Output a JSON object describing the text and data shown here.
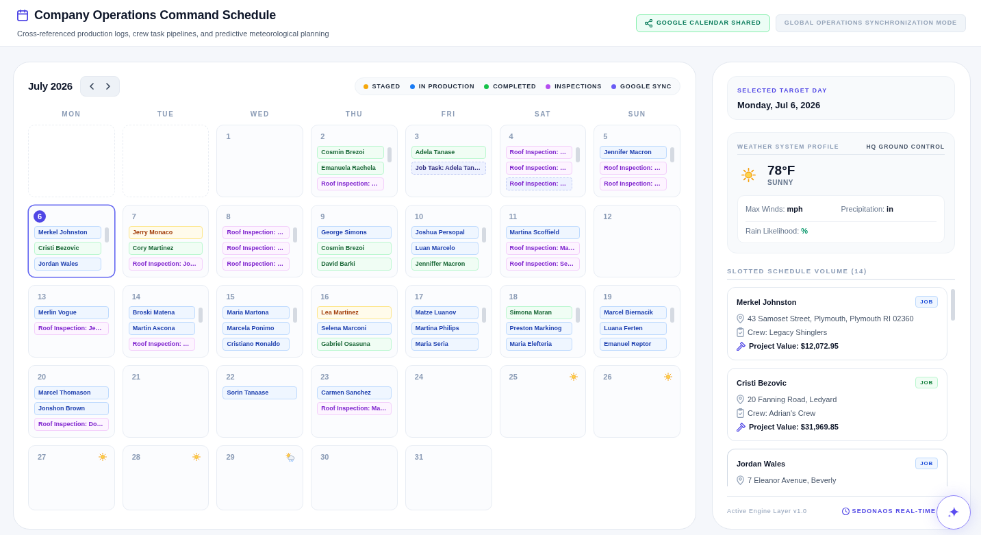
{
  "header": {
    "title": "Company Operations Command Schedule",
    "subtitle": "Cross-referenced production logs, crew task pipelines, and predictive meteorological planning",
    "buttons": [
      {
        "label": "GOOGLE CALENDAR SHARED",
        "kind": "share",
        "disabled": false
      },
      {
        "label": "GLOBAL OPERATIONS SYNCHRONIZATION MODE",
        "kind": "mode",
        "disabled": true
      }
    ]
  },
  "calendar": {
    "month": "July 2026",
    "legend": [
      {
        "label": "STAGED",
        "color": "#f5a70b"
      },
      {
        "label": "IN PRODUCTION",
        "color": "#1a7cf5"
      },
      {
        "label": "COMPLETED",
        "color": "#16c24a"
      },
      {
        "label": "INSPECTIONS",
        "color": "#b44cf0"
      },
      {
        "label": "GOOGLE SYNC",
        "color": "#6a5cf5"
      }
    ],
    "weekdays": [
      "MON",
      "TUE",
      "WED",
      "THU",
      "FRI",
      "SAT",
      "SUN"
    ],
    "cells": [
      {
        "kind": "blank"
      },
      {
        "kind": "blank"
      },
      {
        "kind": "day",
        "date": "1",
        "selected": false,
        "overflow": false
      },
      {
        "kind": "day",
        "date": "2",
        "selected": false,
        "overflow": true,
        "events": [
          {
            "label": "Cosmin Brezoi",
            "kind": "completed",
            "synced": false
          },
          {
            "label": "Emanuela Rachela",
            "kind": "completed",
            "synced": false
          },
          {
            "label": "Roof Inspection: …",
            "kind": "inspection",
            "synced": false
          }
        ]
      },
      {
        "kind": "day",
        "date": "3",
        "selected": false,
        "overflow": false,
        "events": [
          {
            "label": "Adela Tanase",
            "kind": "completed",
            "synced": false
          },
          {
            "label": "Job Task: Adela Tan…",
            "kind": "sync",
            "synced": true
          }
        ]
      },
      {
        "kind": "day",
        "date": "4",
        "selected": false,
        "overflow": true,
        "events": [
          {
            "label": "Roof Inspection: …",
            "kind": "inspection",
            "synced": false
          },
          {
            "label": "Roof Inspection: …",
            "kind": "inspection",
            "synced": false
          },
          {
            "label": "Roof Inspection: …",
            "kind": "inspection",
            "synced": true
          }
        ]
      },
      {
        "kind": "day",
        "date": "5",
        "selected": false,
        "overflow": true,
        "events": [
          {
            "label": "Jennifer Macron",
            "kind": "production",
            "synced": false
          },
          {
            "label": "Roof Inspection: …",
            "kind": "inspection",
            "synced": false
          },
          {
            "label": "Roof Inspection: …",
            "kind": "inspection",
            "synced": false
          }
        ]
      },
      {
        "kind": "day",
        "date": "6",
        "selected": true,
        "overflow": true,
        "events": [
          {
            "label": "Merkel Johnston",
            "kind": "production",
            "synced": false
          },
          {
            "label": "Cristi Bezovic",
            "kind": "completed",
            "synced": false
          },
          {
            "label": "Jordan Wales",
            "kind": "production",
            "synced": false
          }
        ]
      },
      {
        "kind": "day",
        "date": "7",
        "selected": false,
        "overflow": false,
        "events": [
          {
            "label": "Jerry Monaco",
            "kind": "staged",
            "synced": false
          },
          {
            "label": "Cory Martinez",
            "kind": "completed",
            "synced": false
          },
          {
            "label": "Roof Inspection: Jo…",
            "kind": "inspection",
            "synced": false
          }
        ]
      },
      {
        "kind": "day",
        "date": "8",
        "selected": false,
        "overflow": true,
        "events": [
          {
            "label": "Roof Inspection: …",
            "kind": "inspection",
            "synced": false
          },
          {
            "label": "Roof Inspection: …",
            "kind": "inspection",
            "synced": false
          },
          {
            "label": "Roof Inspection: …",
            "kind": "inspection",
            "synced": false
          }
        ]
      },
      {
        "kind": "day",
        "date": "9",
        "selected": false,
        "overflow": false,
        "events": [
          {
            "label": "George Simons",
            "kind": "production",
            "synced": false
          },
          {
            "label": "Cosmin Brezoi",
            "kind": "completed",
            "synced": false
          },
          {
            "label": "David Barki",
            "kind": "completed",
            "synced": false
          }
        ]
      },
      {
        "kind": "day",
        "date": "10",
        "selected": false,
        "overflow": true,
        "events": [
          {
            "label": "Joshua Persopal",
            "kind": "production",
            "synced": false
          },
          {
            "label": "Luan Marcelo",
            "kind": "production",
            "synced": false
          },
          {
            "label": "Jenniffer Macron",
            "kind": "completed",
            "synced": false
          }
        ]
      },
      {
        "kind": "day",
        "date": "11",
        "selected": false,
        "overflow": false,
        "events": [
          {
            "label": "Martina Scoffield",
            "kind": "production",
            "synced": false
          },
          {
            "label": "Roof Inspection: Ma…",
            "kind": "inspection",
            "synced": false
          },
          {
            "label": "Roof Inspection: Se…",
            "kind": "inspection",
            "synced": false
          }
        ]
      },
      {
        "kind": "day",
        "date": "12",
        "selected": false,
        "overflow": false
      },
      {
        "kind": "day",
        "date": "13",
        "selected": false,
        "overflow": false,
        "events": [
          {
            "label": "Merlin Vogue",
            "kind": "production",
            "synced": false
          },
          {
            "label": "Roof Inspection: Je…",
            "kind": "inspection",
            "synced": false
          }
        ]
      },
      {
        "kind": "day",
        "date": "14",
        "selected": false,
        "overflow": true,
        "events": [
          {
            "label": "Broski Matena",
            "kind": "production",
            "synced": false
          },
          {
            "label": "Martin Ascona",
            "kind": "production",
            "synced": false
          },
          {
            "label": "Roof Inspection: …",
            "kind": "inspection",
            "synced": false
          }
        ]
      },
      {
        "kind": "day",
        "date": "15",
        "selected": false,
        "overflow": true,
        "events": [
          {
            "label": "Maria Martona",
            "kind": "production",
            "synced": false
          },
          {
            "label": "Marcela Ponimo",
            "kind": "production",
            "synced": false
          },
          {
            "label": "Cristiano Ronaldo",
            "kind": "production",
            "synced": false
          }
        ]
      },
      {
        "kind": "day",
        "date": "16",
        "selected": false,
        "overflow": false,
        "events": [
          {
            "label": "Lea Martinez",
            "kind": "staged",
            "synced": false
          },
          {
            "label": "Selena Marconi",
            "kind": "production",
            "synced": false
          },
          {
            "label": "Gabriel Osasuna",
            "kind": "completed",
            "synced": false
          }
        ]
      },
      {
        "kind": "day",
        "date": "17",
        "selected": false,
        "overflow": true,
        "events": [
          {
            "label": "Matze Luanov",
            "kind": "production",
            "synced": false
          },
          {
            "label": "Martina Philips",
            "kind": "production",
            "synced": false
          },
          {
            "label": "Maria Seria",
            "kind": "production",
            "synced": false
          }
        ]
      },
      {
        "kind": "day",
        "date": "18",
        "selected": false,
        "overflow": true,
        "events": [
          {
            "label": "Simona Maran",
            "kind": "completed",
            "synced": false
          },
          {
            "label": "Preston Markinog",
            "kind": "production",
            "synced": false
          },
          {
            "label": "Maria Elefteria",
            "kind": "production",
            "synced": false
          }
        ]
      },
      {
        "kind": "day",
        "date": "19",
        "selected": false,
        "overflow": true,
        "events": [
          {
            "label": "Marcel Biernacik",
            "kind": "production",
            "synced": false
          },
          {
            "label": "Luana Ferten",
            "kind": "production",
            "synced": false
          },
          {
            "label": "Emanuel Reptor",
            "kind": "production",
            "synced": false
          }
        ]
      },
      {
        "kind": "day",
        "date": "20",
        "selected": false,
        "overflow": false,
        "events": [
          {
            "label": "Marcel Thomason",
            "kind": "production",
            "synced": false
          },
          {
            "label": "Jonshon Brown",
            "kind": "production",
            "synced": false
          },
          {
            "label": "Roof Inspection: Do…",
            "kind": "inspection",
            "synced": false
          }
        ]
      },
      {
        "kind": "day",
        "date": "21",
        "selected": false,
        "overflow": false
      },
      {
        "kind": "day",
        "date": "22",
        "selected": false,
        "overflow": false,
        "events": [
          {
            "label": "Sorin Tanaase",
            "kind": "production",
            "synced": false
          }
        ]
      },
      {
        "kind": "day",
        "date": "23",
        "selected": false,
        "overflow": false,
        "events": [
          {
            "label": "Carmen Sanchez",
            "kind": "production",
            "synced": false
          },
          {
            "label": "Roof Inspection: Ma…",
            "kind": "inspection",
            "synced": false
          }
        ]
      },
      {
        "kind": "day",
        "date": "24",
        "selected": false,
        "overflow": false
      },
      {
        "kind": "day",
        "date": "25",
        "selected": false,
        "overflow": false,
        "weather": {
          "kind": "sunny"
        }
      },
      {
        "kind": "day",
        "date": "26",
        "selected": false,
        "overflow": false,
        "weather": {
          "kind": "sunny"
        }
      },
      {
        "kind": "day",
        "date": "27",
        "selected": false,
        "overflow": false,
        "weather": {
          "kind": "sunny"
        }
      },
      {
        "kind": "day",
        "date": "28",
        "selected": false,
        "overflow": false,
        "weather": {
          "kind": "sunny"
        }
      },
      {
        "kind": "day",
        "date": "29",
        "selected": false,
        "overflow": false,
        "weather": {
          "kind": "storm"
        }
      },
      {
        "kind": "day",
        "date": "30",
        "selected": false,
        "overflow": false
      },
      {
        "kind": "day",
        "date": "31",
        "selected": false,
        "overflow": false
      }
    ]
  },
  "sidebar": {
    "selected_day": {
      "label": "SELECTED TARGET DAY",
      "value": "Monday, Jul 6, 2026"
    },
    "weather": {
      "title": "WEATHER SYSTEM PROFILE",
      "location": "HQ GROUND CONTROL",
      "kind": "sunny",
      "temperature": "78°F",
      "condition": "SUNNY",
      "stats": [
        {
          "label": "Max Winds:",
          "value": "mph",
          "color": "#0f172a"
        },
        {
          "label": "Precipitation:",
          "value": "in",
          "color": "#0f172a"
        },
        {
          "label": "Rain Likelihood:",
          "value": "%",
          "color": "#059669"
        }
      ]
    },
    "schedule": {
      "title": "SLOTTED SCHEDULE VOLUME (14)",
      "items": [
        {
          "name": "Merkel Johnston",
          "badge": "JOB",
          "kind": "production",
          "address": "43 Samoset Street, Plymouth, Plymouth RI 02360",
          "crew": "Crew: Legacy Shinglers",
          "value": "Project Value: $12,072.95"
        },
        {
          "name": "Cristi Bezovic",
          "badge": "JOB",
          "kind": "completed",
          "address": "20 Fanning Road, Ledyard",
          "crew": "Crew: Adrian's Crew",
          "value": "Project Value: $31,969.85"
        },
        {
          "name": "Jordan Wales",
          "badge": "JOB",
          "kind": "production",
          "address": "7 Eleanor Avenue, Beverly"
        }
      ]
    },
    "footer": {
      "version": "Active Engine Layer v1.0",
      "status": "SEDONAOS REAL-TIME"
    }
  }
}
